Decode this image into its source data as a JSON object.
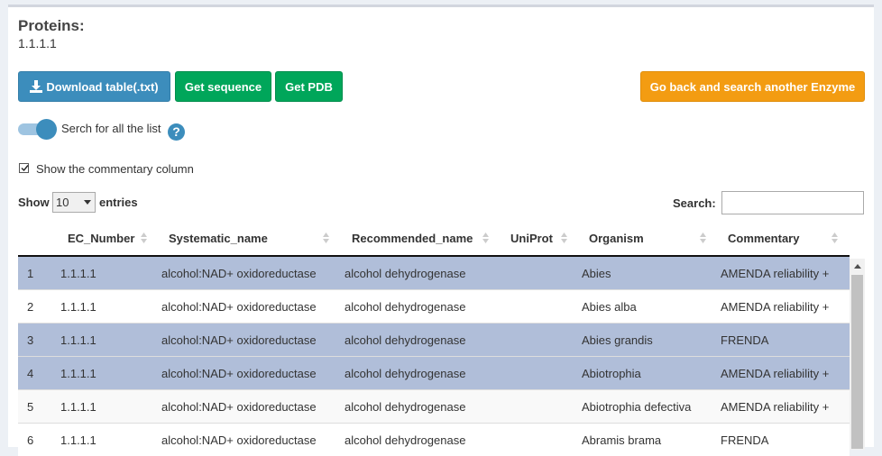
{
  "header": {
    "title": "Proteins:",
    "ec": "1.1.1.1"
  },
  "buttons": {
    "download": "Download table(.txt)",
    "get_sequence": "Get sequence",
    "get_pdb": "Get PDB",
    "go_back": "Go back and search another Enzyme"
  },
  "toggle": {
    "label": "Serch for all the list",
    "on": true
  },
  "help_icon": "?",
  "checkbox": {
    "label": "Show the commentary column",
    "checked": true
  },
  "length": {
    "show": "Show",
    "value": "10",
    "entries": "entries"
  },
  "search": {
    "label": "Search:",
    "value": ""
  },
  "table": {
    "columns": [
      "EC_Number",
      "Systematic_name",
      "Recommended_name",
      "UniProt",
      "Organism",
      "Commentary"
    ],
    "rows": [
      {
        "n": "1",
        "ec": "1.1.1.1",
        "sys": "alcohol:NAD+ oxidoreductase",
        "rec": "alcohol dehydrogenase",
        "uniprot": "",
        "org": "Abies",
        "comm": "AMENDA reliability +",
        "selected": true
      },
      {
        "n": "2",
        "ec": "1.1.1.1",
        "sys": "alcohol:NAD+ oxidoreductase",
        "rec": "alcohol dehydrogenase",
        "uniprot": "",
        "org": "Abies alba",
        "comm": "AMENDA reliability +",
        "selected": false
      },
      {
        "n": "3",
        "ec": "1.1.1.1",
        "sys": "alcohol:NAD+ oxidoreductase",
        "rec": "alcohol dehydrogenase",
        "uniprot": "",
        "org": "Abies grandis",
        "comm": "FRENDA",
        "selected": true
      },
      {
        "n": "4",
        "ec": "1.1.1.1",
        "sys": "alcohol:NAD+ oxidoreductase",
        "rec": "alcohol dehydrogenase",
        "uniprot": "",
        "org": "Abiotrophia",
        "comm": "AMENDA reliability +",
        "selected": true
      },
      {
        "n": "5",
        "ec": "1.1.1.1",
        "sys": "alcohol:NAD+ oxidoreductase",
        "rec": "alcohol dehydrogenase",
        "uniprot": "",
        "org": "Abiotrophia defectiva",
        "comm": "AMENDA reliability +",
        "selected": false
      },
      {
        "n": "6",
        "ec": "1.1.1.1",
        "sys": "alcohol:NAD+ oxidoreductase",
        "rec": "alcohol dehydrogenase",
        "uniprot": "",
        "org": "Abramis brama",
        "comm": "FRENDA",
        "selected": false
      }
    ]
  },
  "colors": {
    "primary": "#3c8dbc",
    "success": "#00a65a",
    "warning": "#f39c12",
    "selected_row": "#b0bed9"
  }
}
